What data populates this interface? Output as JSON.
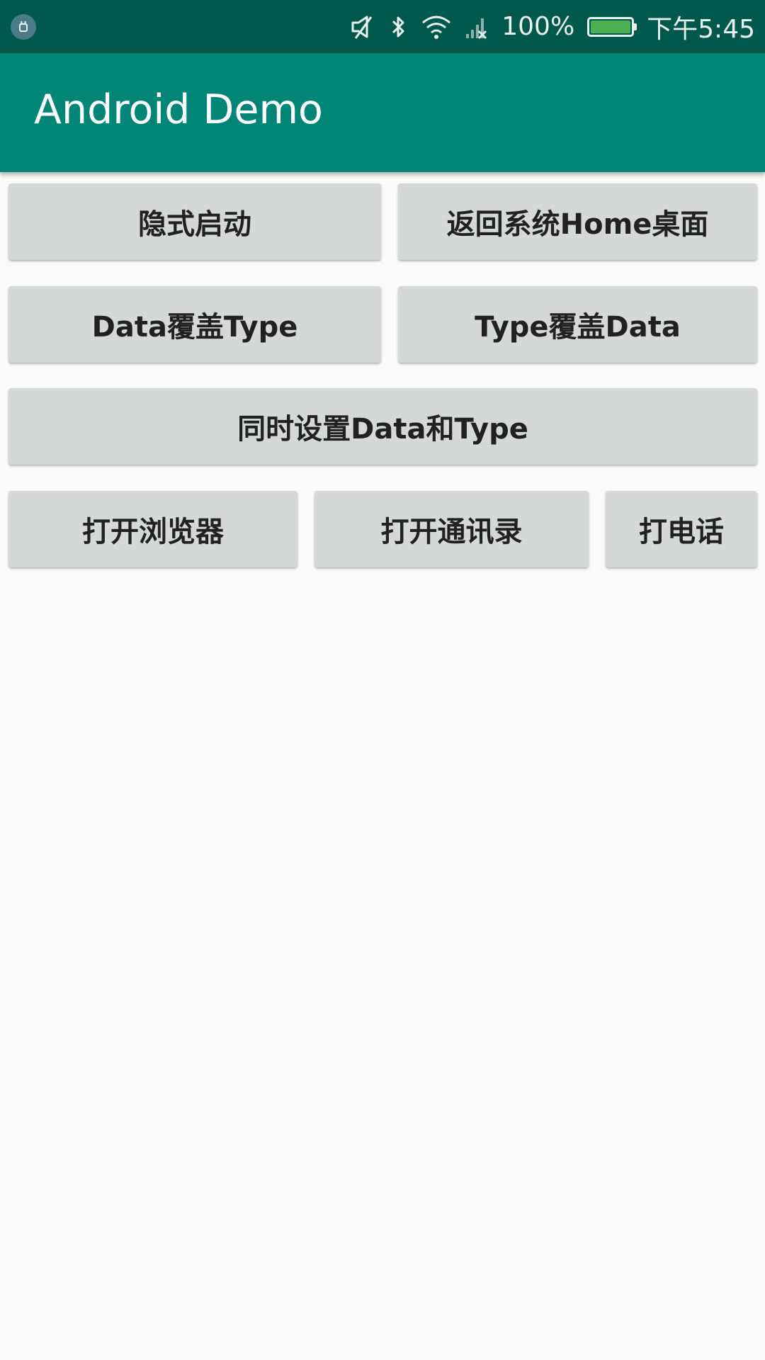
{
  "status_bar": {
    "notification_icon": "android-debug-icon",
    "icons": [
      "mute-icon",
      "bluetooth-icon",
      "wifi-icon",
      "signal-no-service-icon"
    ],
    "battery_percent": "100%",
    "battery_level": 1.0,
    "time": "下午5:45"
  },
  "app_bar": {
    "title": "Android Demo",
    "color": "#008577"
  },
  "buttons": {
    "implicit_start": "隐式启动",
    "return_home": "返回系统Home桌面",
    "data_override_type": "Data覆盖Type",
    "type_override_data": "Type覆盖Data",
    "set_data_and_type": "同时设置Data和Type",
    "open_browser": "打开浏览器",
    "open_contacts": "打开通讯录",
    "make_call": "打电话"
  },
  "colors": {
    "status_bar": "#00574b",
    "button": "#d6d7d7",
    "background": "#fafafa"
  }
}
